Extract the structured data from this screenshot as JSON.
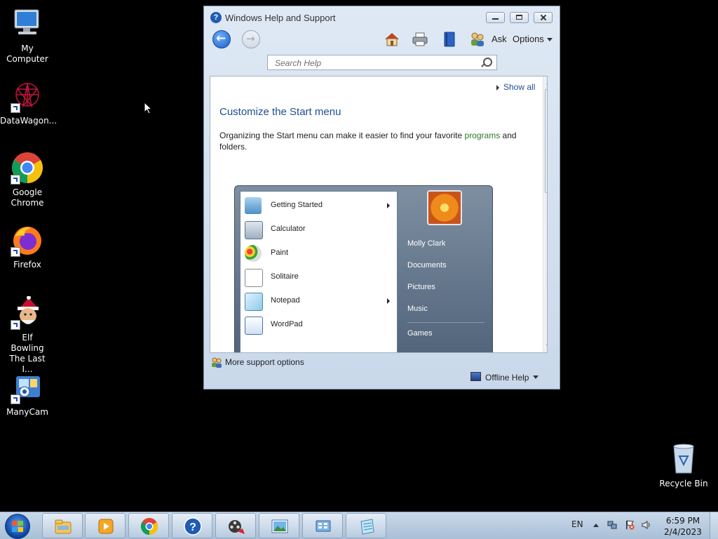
{
  "desktop": {
    "icons": [
      {
        "label": "My Computer",
        "icon": "computer-icon"
      },
      {
        "label": "DataWagon...",
        "icon": "datawagon-icon"
      },
      {
        "label": "Google Chrome",
        "icon": "chrome-icon"
      },
      {
        "label": "Firefox",
        "icon": "firefox-icon"
      },
      {
        "label": "Elf Bowling The Last I...",
        "icon": "elf-bowling-icon"
      },
      {
        "label": "ManyCam",
        "icon": "manycam-icon"
      },
      {
        "label": "Recycle Bin",
        "icon": "recycle-bin-icon"
      }
    ]
  },
  "window": {
    "title": "Windows Help and Support",
    "toolbar": {
      "ask_label": "Ask",
      "options_label": "Options"
    },
    "search": {
      "placeholder": "Search Help"
    },
    "content": {
      "show_all": "Show all",
      "heading": "Customize the Start menu",
      "paragraph_before_link": "Organizing the Start menu can make it easier to find your favorite ",
      "paragraph_link": "programs",
      "paragraph_after_link": " and folders."
    },
    "start_menu_illustration": {
      "left_items": [
        {
          "label": "Getting Started",
          "has_submenu": true
        },
        {
          "label": "Calculator",
          "has_submenu": false
        },
        {
          "label": "Paint",
          "has_submenu": false
        },
        {
          "label": "Solitaire",
          "has_submenu": false
        },
        {
          "label": "Notepad",
          "has_submenu": true
        },
        {
          "label": "WordPad",
          "has_submenu": false
        }
      ],
      "right_items": [
        "Molly Clark",
        "Documents",
        "Pictures",
        "Music",
        "Games"
      ]
    },
    "footer": {
      "more_support": "More support options",
      "offline_help": "Offline Help"
    }
  },
  "taskbar": {
    "pinned": [
      "explorer-icon",
      "media-player-icon",
      "chrome-icon",
      "help-icon",
      "movie-maker-icon",
      "photo-viewer-icon",
      "control-panel-icon",
      "notepad-icon"
    ],
    "language": "EN",
    "time": "6:59 PM",
    "date": "2/4/2023"
  }
}
